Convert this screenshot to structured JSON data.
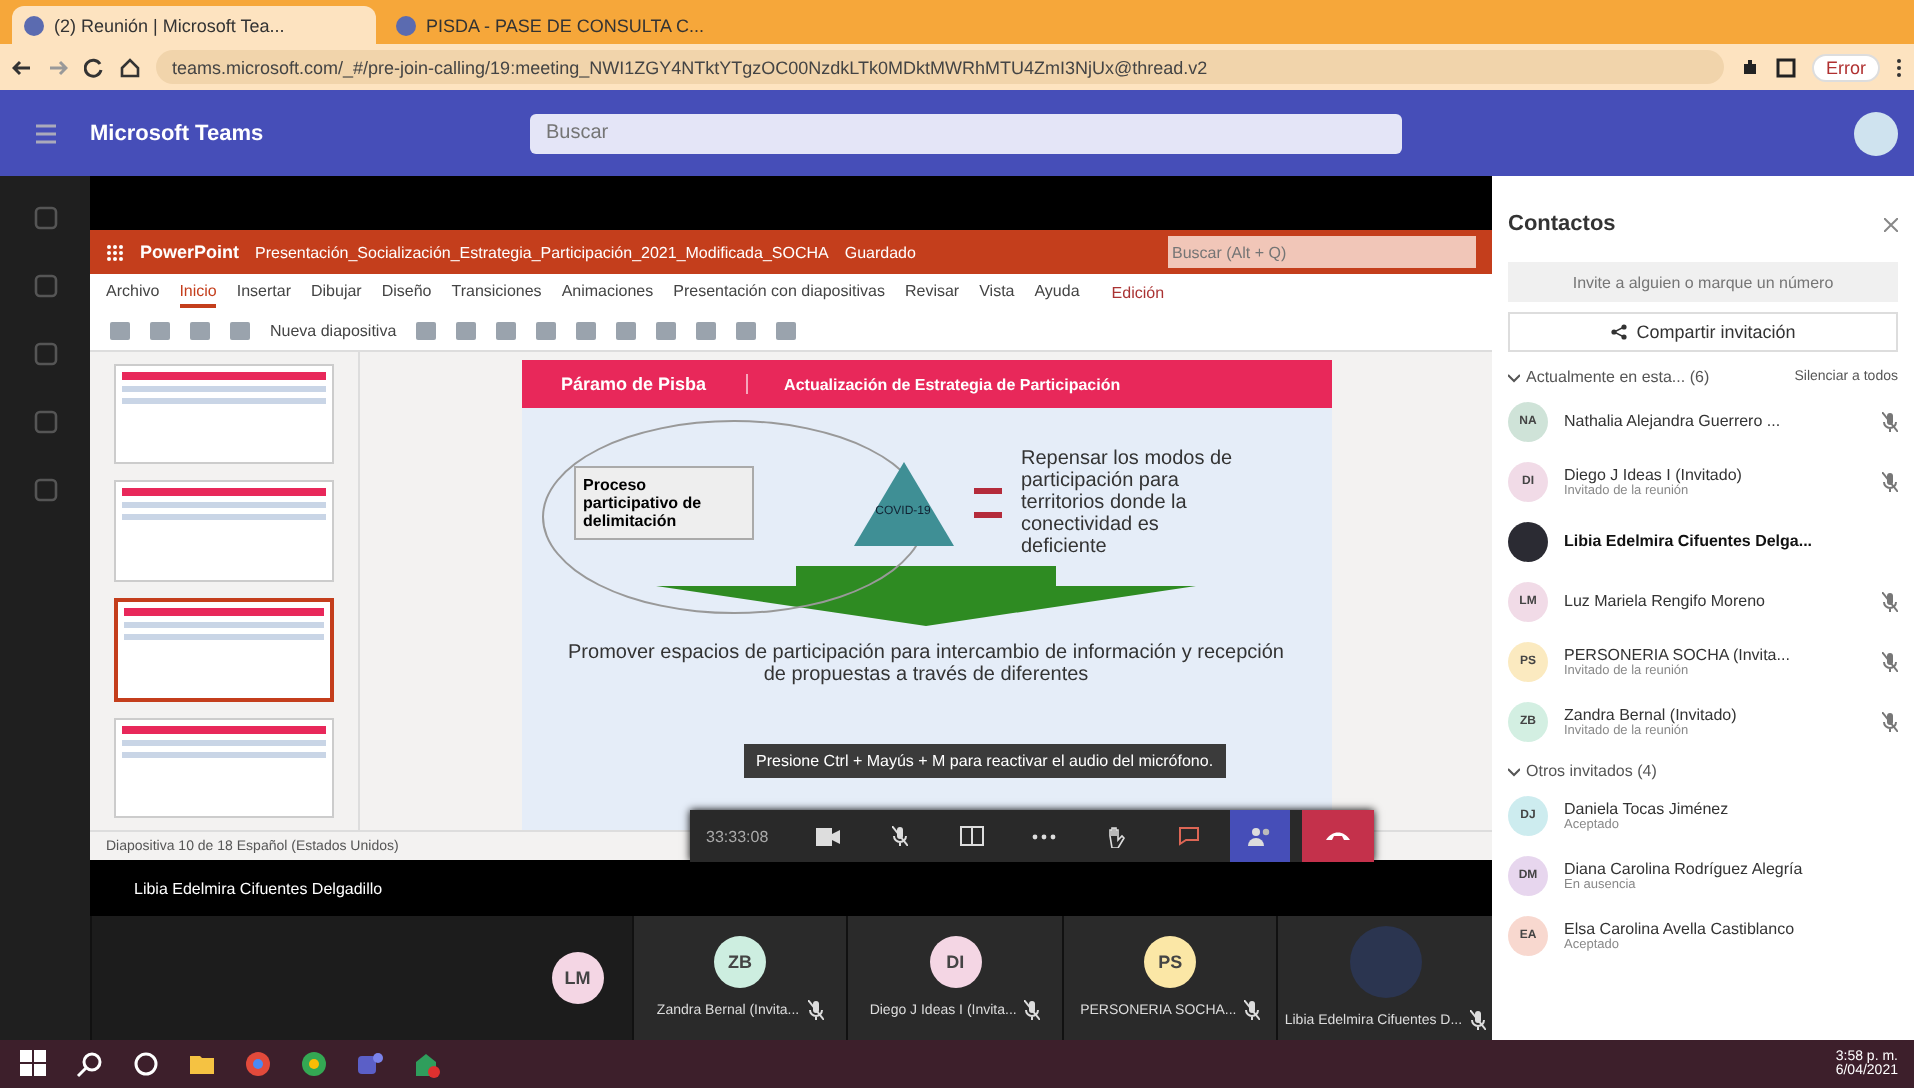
{
  "browser": {
    "tabs": [
      {
        "title": "(2) Reunión | Microsoft Tea...",
        "selected": true
      },
      {
        "title": "PISDA - PASE DE CONSULTA C...",
        "selected": false
      }
    ],
    "address": "teams.microsoft.com/_#/pre-join-calling/19:meeting_NWI1ZGY4NTktYTgzOC00NzdkLTk0MDktMWRhMTU4ZmI3NjUx@thread.v2",
    "profile": "Error"
  },
  "teams": {
    "title": "Microsoft Teams",
    "search_placeholder": "Buscar"
  },
  "powerpoint": {
    "app": "PowerPoint",
    "file": "Presentación_Socialización_Estrategia_Participación_2021_Modificada_SOCHA",
    "saved": "Guardado",
    "search_placeholder": "Buscar (Alt + Q)",
    "ribbon_tabs": [
      {
        "label": "Archivo",
        "selected": false
      },
      {
        "label": "Inicio",
        "selected": true
      },
      {
        "label": "Insertar",
        "selected": false
      },
      {
        "label": "Dibujar",
        "selected": false
      },
      {
        "label": "Diseño",
        "selected": false
      },
      {
        "label": "Transiciones",
        "selected": false
      },
      {
        "label": "Animaciones",
        "selected": false
      },
      {
        "label": "Presentación con diapositivas",
        "selected": false
      },
      {
        "label": "Revisar",
        "selected": false
      },
      {
        "label": "Vista",
        "selected": false
      },
      {
        "label": "Ayuda",
        "selected": false
      }
    ],
    "edit_button": "Edición",
    "new_slide": "Nueva diapositiva",
    "thumbnails": [
      {
        "selected": false
      },
      {
        "selected": false
      },
      {
        "selected": true
      },
      {
        "selected": false
      }
    ],
    "slide": {
      "header_left": "Páramo de Pisba",
      "header_right": "Actualización de Estrategia de Participación",
      "box": "Proceso participativo de delimitación",
      "triangle": "COVID-19",
      "right_text": "Repensar los modos de participación para territorios donde la conectividad es deficiente",
      "bottom_text": "Promover espacios de participación para intercambio de información y recepción de propuestas a través de diferentes"
    },
    "status": "Diapositiva 10 de 18   Español (Estados Unidos)"
  },
  "tooltip": "Presione Ctrl + Mayús + M para reactivar el audio del micrófono.",
  "meeting_bar": {
    "timer": "33:33:08",
    "mic_muted": true
  },
  "presenter_name": "Libia Edelmira Cifuentes Delgadillo",
  "tiles": [
    {
      "initials": "LM",
      "color": "#f4d6e4",
      "kind": "avatar"
    },
    {
      "initials": "ZB",
      "name": "Zandra Bernal (Invita...",
      "color": "#cdeee0",
      "kind": "avatar"
    },
    {
      "initials": "DI",
      "name": "Diego J Ideas I (Invita...",
      "color": "#f4d6e4",
      "kind": "avatar"
    },
    {
      "initials": "PS",
      "name": "PERSONERIA SOCHA...",
      "color": "#fbe7a6",
      "kind": "avatar"
    },
    {
      "name": "Libia Edelmira Cifuentes D...",
      "color": "#2b3550",
      "kind": "photo"
    }
  ],
  "contacts": {
    "title": "Contactos",
    "invite_placeholder": "Invite a alguien o marque un número",
    "share_button": "Compartir invitación",
    "mute_all": "Silenciar a todos",
    "groups": [
      {
        "label": "Actualmente en esta... (6)",
        "expanded": true,
        "people": [
          {
            "initials": "NA",
            "name": "Nathalia Alejandra Guerrero ...",
            "color": "#cfe3d8",
            "muted": true,
            "bold": false
          },
          {
            "initials": "DI",
            "name": "Diego J Ideas I (Invitado)",
            "subtitle": "Invitado de la reunión",
            "color": "#f1dbe7",
            "muted": true,
            "bold": false
          },
          {
            "name": "Libia Edelmira Cifuentes Delga...",
            "color": "#2b2b33",
            "muted": false,
            "bold": true
          },
          {
            "initials": "LM",
            "name": "Luz Mariela Rengifo Moreno",
            "color": "#f1dbe7",
            "muted": true,
            "bold": false
          },
          {
            "initials": "PS",
            "name": "PERSONERIA SOCHA (Invita...",
            "subtitle": "Invitado de la reunión",
            "color": "#fbeac0",
            "muted": true,
            "bold": false
          },
          {
            "initials": "ZB",
            "name": "Zandra Bernal (Invitado)",
            "subtitle": "Invitado de la reunión",
            "color": "#d3efe2",
            "muted": true,
            "bold": false
          }
        ]
      },
      {
        "label": "Otros invitados (4)",
        "expanded": true,
        "people": [
          {
            "initials": "DJ",
            "name": "Daniela Tocas Jiménez",
            "subtitle": "Aceptado",
            "color": "#cdecef",
            "muted": false,
            "bold": false
          },
          {
            "initials": "DM",
            "name": "Diana Carolina Rodríguez Alegría",
            "subtitle": "En ausencia",
            "color": "#e7d6ee",
            "muted": false,
            "bold": false
          },
          {
            "initials": "EA",
            "name": "Elsa Carolina Avella Castiblanco",
            "subtitle": "Aceptado",
            "color": "#f8d8cf",
            "muted": false,
            "bold": false
          }
        ]
      }
    ]
  },
  "taskbar": {
    "time": "3:58 p. m.",
    "date": "6/04/2021"
  }
}
